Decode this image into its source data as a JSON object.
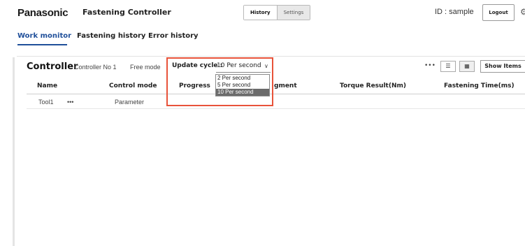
{
  "header": {
    "brand": "Panasonic",
    "app_title": "Fastening Controller",
    "mode_tabs": [
      {
        "label": "History",
        "active": true
      },
      {
        "label": "Settings",
        "active": false
      }
    ],
    "user_id": "ID : sample",
    "logout_label": "Logout",
    "settings_icon": "gear-icon"
  },
  "nav": {
    "tabs": [
      {
        "label": "Work monitor",
        "active": true
      },
      {
        "label": "Fastening history",
        "active": false
      },
      {
        "label": "Error history",
        "active": false
      }
    ]
  },
  "controller": {
    "title": "Controller",
    "number": "Controller No 1",
    "mode": "Free mode",
    "update_cycle": {
      "label": "Update cycle :",
      "selected": "10 Per second",
      "options": [
        "2 Per second",
        "5 Per second",
        "10 Per second"
      ]
    },
    "more_label": "•••",
    "view_list_icon": "list-view-icon",
    "view_grid_icon": "grid-view-icon",
    "show_items_label": "Show Items"
  },
  "table": {
    "columns": [
      "Name",
      "Control mode",
      "Progress",
      "gment",
      "Torque Result(Nm)",
      "Fastening Time(ms)"
    ],
    "rows": [
      {
        "name": "Tool1",
        "more": "•••",
        "control_mode": "Parameter"
      }
    ]
  },
  "colors": {
    "accent": "#1f4f9a",
    "highlight": "#e8533a",
    "dropdown_selected_bg": "#6b6b6b"
  }
}
